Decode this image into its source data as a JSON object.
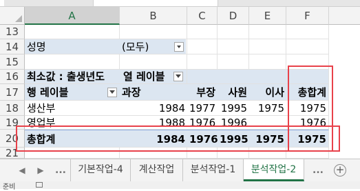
{
  "columns": [
    "A",
    "B",
    "C",
    "D",
    "E",
    "F"
  ],
  "selected_column": "A",
  "rows": [
    "13",
    "14",
    "15",
    "16",
    "17",
    "18",
    "19",
    "20",
    "21"
  ],
  "pivot": {
    "filter_label": "성명",
    "filter_value": "(모두)",
    "value_label": "최소값 : 출생년도",
    "column_labels_header": "열 레이블",
    "row_labels_header": "행 레이블",
    "col_headers": [
      "과장",
      "부장",
      "사원",
      "이사",
      "총합계"
    ],
    "data_rows": [
      {
        "label": "생산부",
        "values": [
          "1984",
          "1977",
          "1995",
          "1975",
          "1975"
        ]
      },
      {
        "label": "영업부",
        "values": [
          "1988",
          "1976",
          "1996",
          "",
          "1976"
        ]
      }
    ],
    "grand_total": {
      "label": "총합계",
      "values": [
        "1984",
        "1976",
        "1995",
        "1975",
        "1975"
      ]
    }
  },
  "sheet_tabs": {
    "ellipsis_left": "...",
    "tabs": [
      "기본작업-4",
      "계산작업",
      "분석작업-1",
      "분석작업-2"
    ],
    "active": "분석작업-2",
    "ellipsis_right": "...",
    "add_sheet": "+"
  },
  "status": {
    "text": "준비"
  },
  "highlight_color": "#e8414a",
  "band_color": "#dce6f1",
  "accent_color": "#217346"
}
